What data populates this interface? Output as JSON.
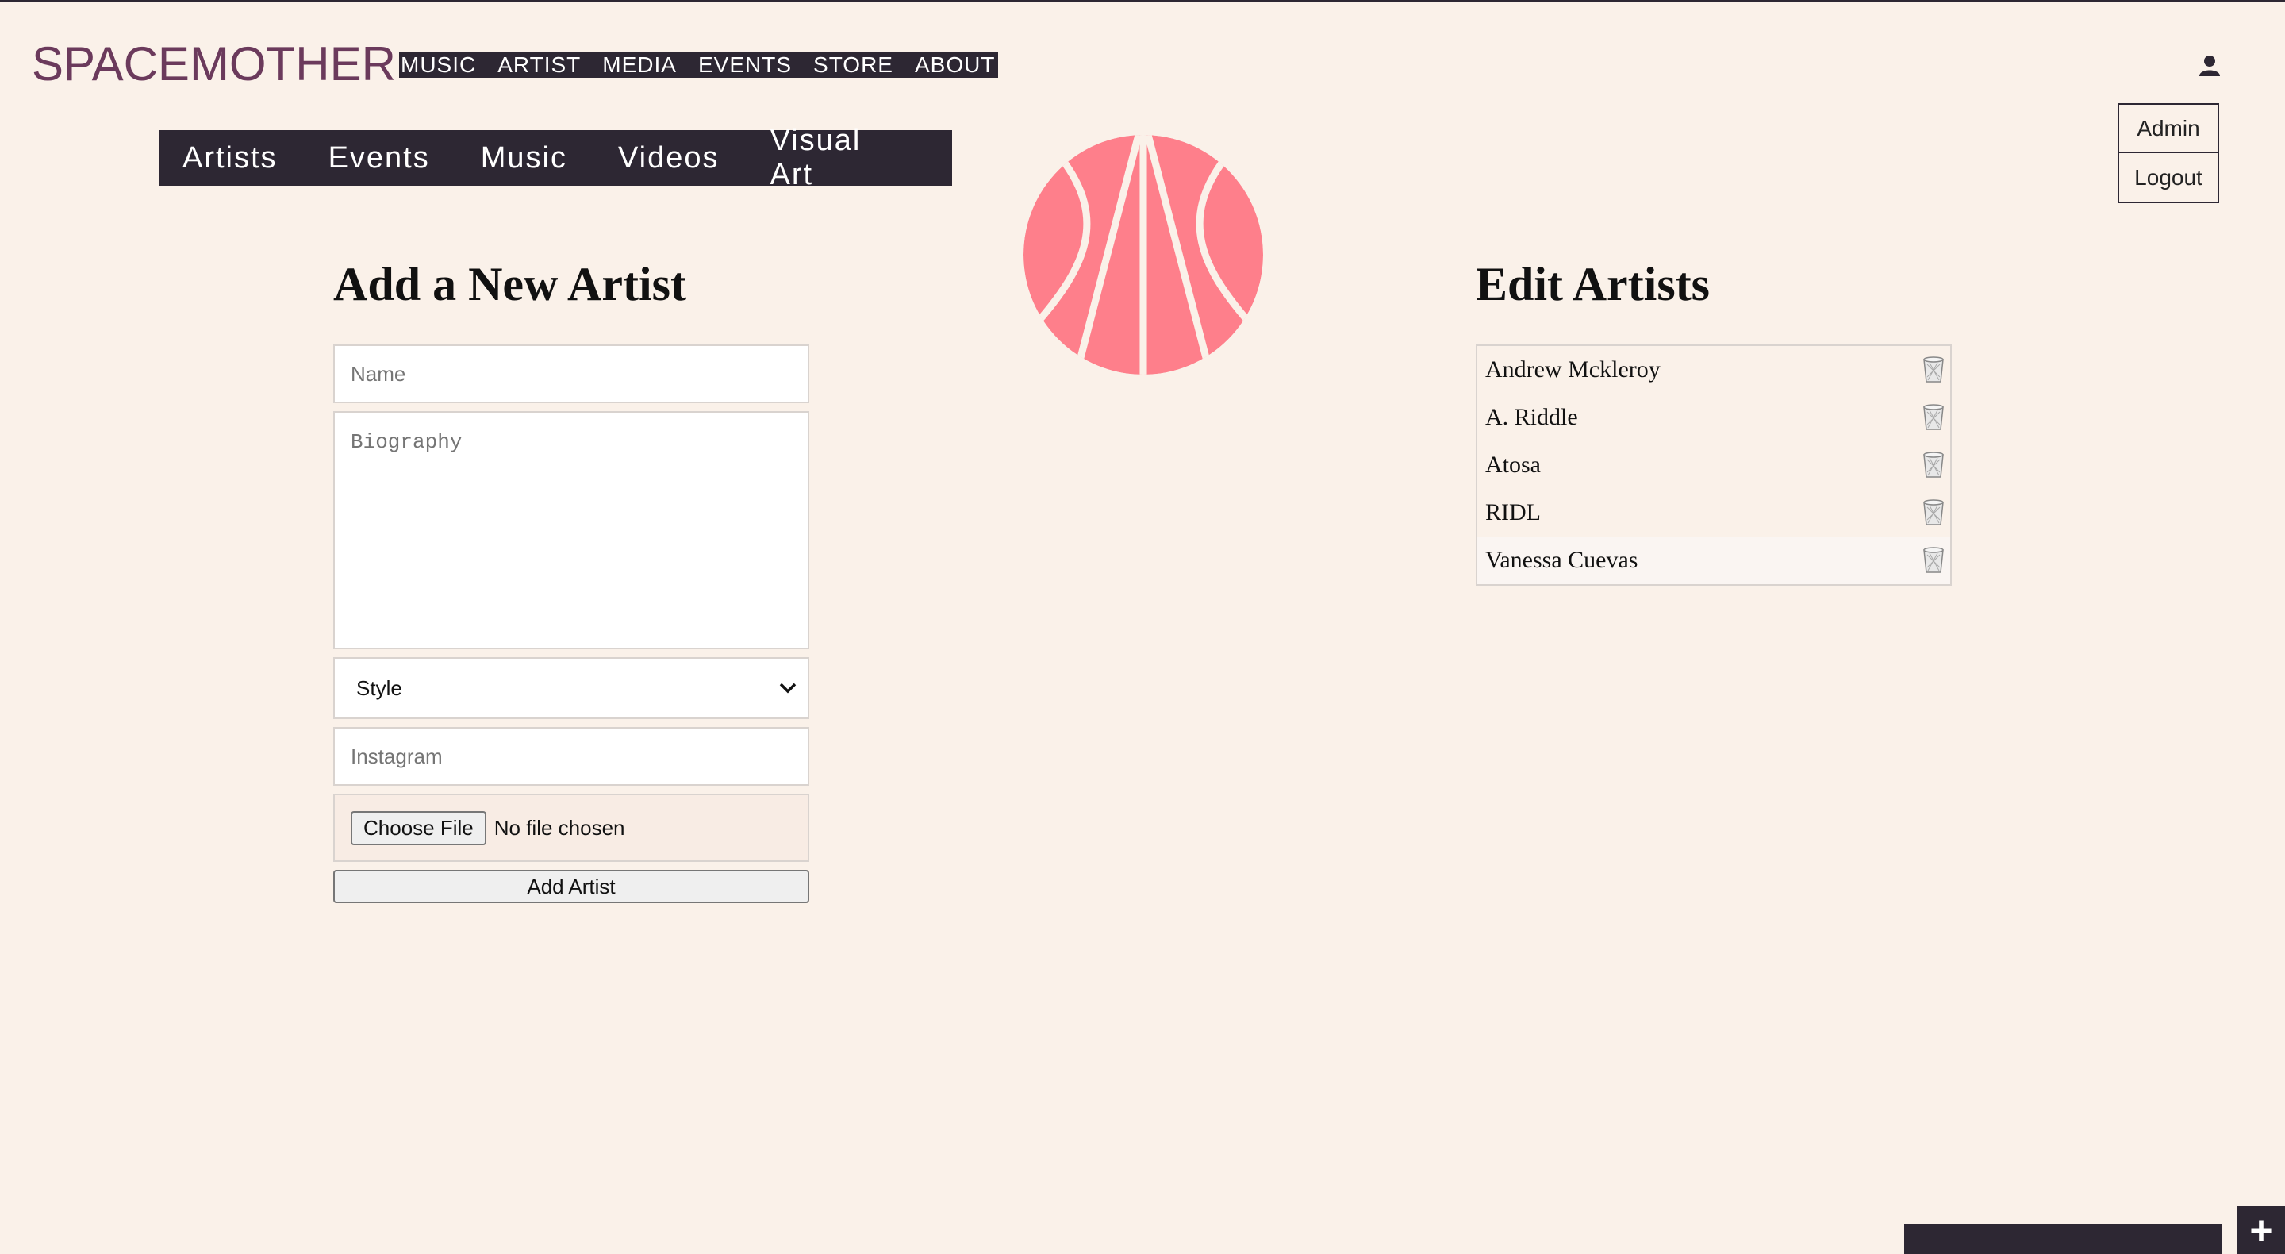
{
  "header": {
    "logo": "SPACEMOTHER",
    "nav": [
      "MUSIC",
      "ARTIST",
      "MEDIA",
      "EVENTS",
      "STORE",
      "ABOUT"
    ]
  },
  "user_menu": {
    "admin": "Admin",
    "logout": "Logout"
  },
  "subnav": [
    "Artists",
    "Events",
    "Music",
    "Videos",
    "Visual Art"
  ],
  "add_form": {
    "title": "Add a New Artist",
    "name_placeholder": "Name",
    "bio_placeholder": "Biography",
    "style_selected": "Style",
    "instagram_placeholder": "Instagram",
    "file_button": "Choose File",
    "file_status": "No file chosen",
    "submit": "Add Artist"
  },
  "edit": {
    "title": "Edit Artists",
    "artists": [
      "Andrew Mckleroy",
      "A. Riddle",
      "Atosa",
      "RIDL",
      "Vanessa Cuevas"
    ]
  },
  "fab": {
    "label": "+"
  },
  "colors": {
    "dark": "#2d2733",
    "accent": "#fe7f8b",
    "logo": "#6b3a5c",
    "background": "#faf1e9"
  }
}
